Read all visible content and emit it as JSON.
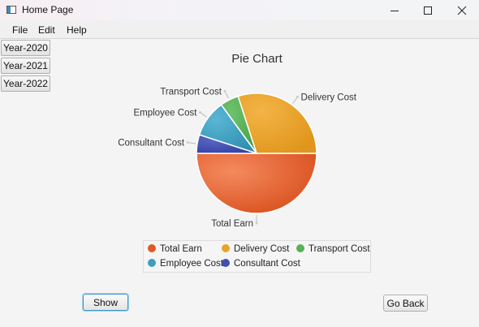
{
  "window": {
    "title": "Home Page"
  },
  "menu": [
    "File",
    "Edit",
    "Help"
  ],
  "years": [
    "Year-2020",
    "Year-2021",
    "Year-2022"
  ],
  "buttons": {
    "show": "Show",
    "back": "Go Back"
  },
  "colors": {
    "total_earn": "#e05a28",
    "delivery_cost": "#e8a32a",
    "transport_cost": "#57b257",
    "employee_cost": "#3e9fc0",
    "consultant_cost": "#4250b3"
  },
  "chart_data": {
    "type": "pie",
    "title": "Pie Chart",
    "start_angle": 90,
    "direction": "counterclockwise",
    "slices": [
      {
        "label": "Total Earn",
        "value": 50
      },
      {
        "label": "Delivery Cost",
        "value": 30
      },
      {
        "label": "Transport Cost",
        "value": 5
      },
      {
        "label": "Employee Cost",
        "value": 10
      },
      {
        "label": "Consultant Cost",
        "value": 5
      }
    ],
    "legend": [
      {
        "label": "Total Earn",
        "color": "#e05a28"
      },
      {
        "label": "Delivery Cost",
        "color": "#e8a32a"
      },
      {
        "label": "Transport Cost",
        "color": "#57b257"
      },
      {
        "label": "Employee Cost",
        "color": "#3e9fc0"
      },
      {
        "label": "Consultant Cost",
        "color": "#4250b3"
      }
    ],
    "legend_placement": "bottom"
  }
}
